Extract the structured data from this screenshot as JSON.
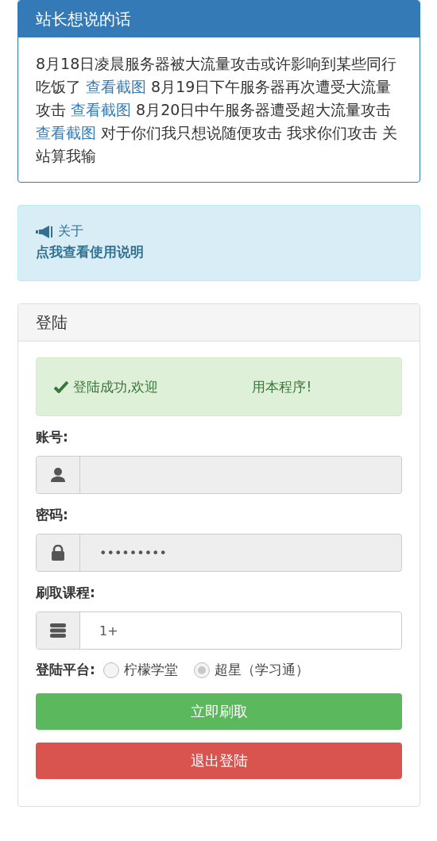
{
  "notice_panel": {
    "title": "站长想说的话",
    "segments": [
      {
        "kind": "text",
        "text": "8月18日凌晨服务器被大流量攻击或许影响到某些同行吃饭了 "
      },
      {
        "kind": "link",
        "text": "查看截图"
      },
      {
        "kind": "text",
        "text": " 8月19日下午服务器再次遭受大流量攻击 "
      },
      {
        "kind": "link",
        "text": "查看截图"
      },
      {
        "kind": "text",
        "text": " 8月20日中午服务器遭受超大流量攻击 "
      },
      {
        "kind": "link",
        "text": "查看截图"
      },
      {
        "kind": "text",
        "text": " 对于你们我只想说随便攻击 我求你们攻击 关站算我输"
      }
    ]
  },
  "about_alert": {
    "label": "关于",
    "link": "点我查看使用说明"
  },
  "login_panel": {
    "title": "登陆",
    "success_message": {
      "start": "登陆成功,欢迎",
      "end": "用本程序!"
    },
    "fields": [
      {
        "kind": "user",
        "label": "账号:",
        "disabled": true
      },
      {
        "kind": "lock",
        "label": "密码:",
        "value": "•••••••••",
        "disabled": true
      },
      {
        "kind": "list",
        "label": "刷取课程:",
        "value": "1+",
        "disabled": false
      }
    ],
    "platform": {
      "label": "登陆平台:",
      "options": [
        {
          "label": "柠檬学堂",
          "selected": false
        },
        {
          "label": "超星（学习通）",
          "selected": true
        }
      ]
    },
    "buttons": [
      {
        "kind": "success",
        "label": "立即刷取"
      },
      {
        "kind": "danger",
        "label": "退出登陆"
      }
    ]
  }
}
